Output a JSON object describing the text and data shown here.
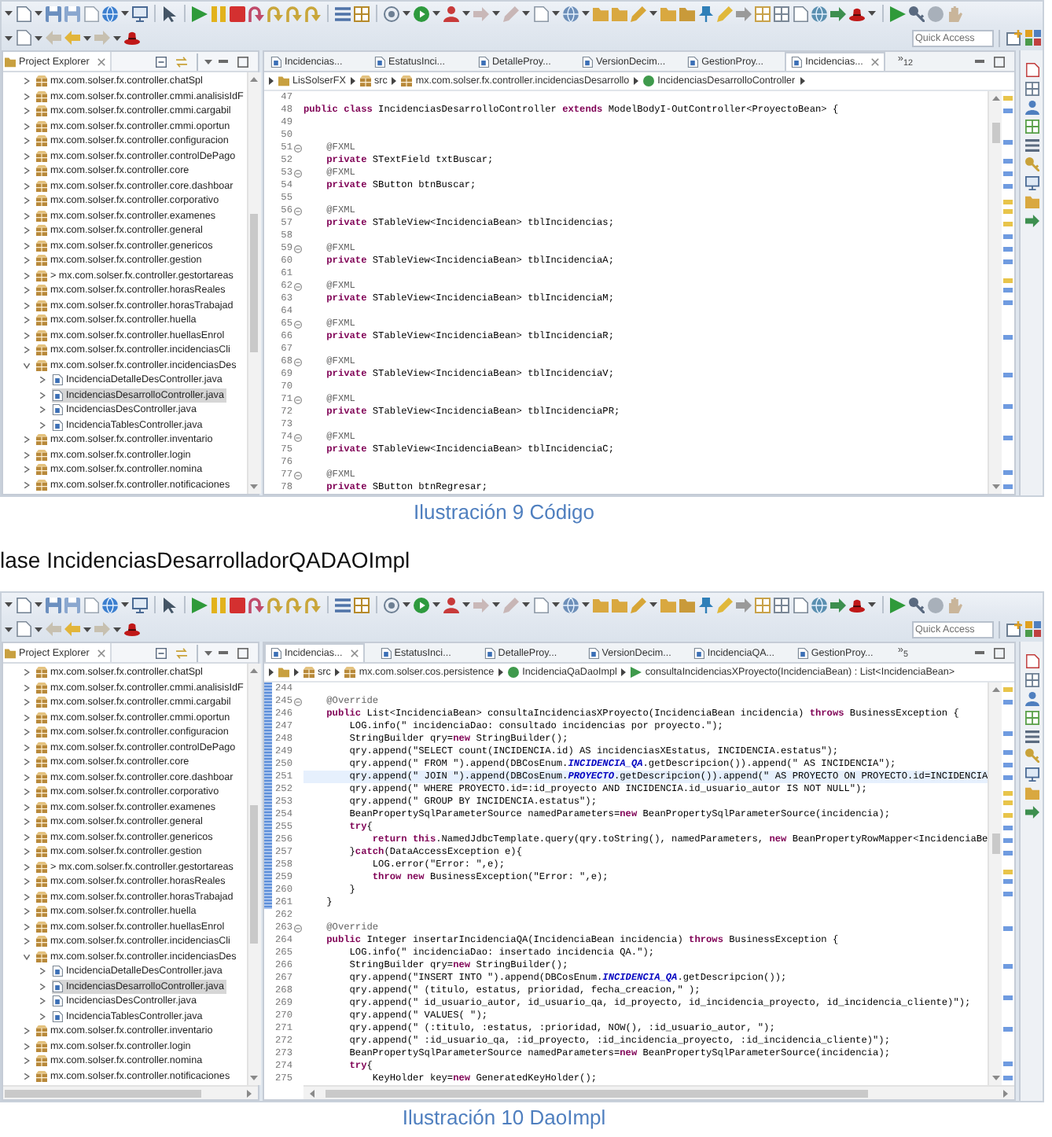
{
  "blocks": [
    {
      "kind": "screenshot",
      "horizontal_scrollbar": false,
      "quick_access": {
        "placeholder": "Quick Access"
      },
      "explorer": {
        "tab": "Project Explorer",
        "items": [
          {
            "label": "mx.com.solser.fx.controller.chatSpl",
            "kind": "package",
            "expanded": false,
            "selected": false
          },
          {
            "label": "mx.com.solser.fx.controller.cmmi.analisisIdF",
            "kind": "package",
            "expanded": false,
            "selected": false
          },
          {
            "label": "mx.com.solser.fx.controller.cmmi.cargabil",
            "kind": "package",
            "expanded": false,
            "selected": false
          },
          {
            "label": "mx.com.solser.fx.controller.cmmi.oportun",
            "kind": "package",
            "expanded": false,
            "selected": false
          },
          {
            "label": "mx.com.solser.fx.controller.configuracion",
            "kind": "package",
            "expanded": false,
            "selected": false
          },
          {
            "label": "mx.com.solser.fx.controller.controlDePago",
            "kind": "package",
            "expanded": false,
            "selected": false
          },
          {
            "label": "mx.com.solser.fx.controller.core",
            "kind": "package",
            "expanded": false,
            "selected": false
          },
          {
            "label": "mx.com.solser.fx.controller.core.dashboar",
            "kind": "package",
            "expanded": false,
            "selected": false
          },
          {
            "label": "mx.com.solser.fx.controller.corporativo",
            "kind": "package",
            "expanded": false,
            "selected": false
          },
          {
            "label": "mx.com.solser.fx.controller.examenes",
            "kind": "package",
            "expanded": false,
            "selected": false
          },
          {
            "label": "mx.com.solser.fx.controller.general",
            "kind": "package",
            "expanded": false,
            "selected": false
          },
          {
            "label": "mx.com.solser.fx.controller.genericos",
            "kind": "package",
            "expanded": false,
            "selected": false
          },
          {
            "label": "mx.com.solser.fx.controller.gestion",
            "kind": "package",
            "expanded": false,
            "selected": false
          },
          {
            "label": "> mx.com.solser.fx.controller.gestortareas",
            "kind": "package",
            "expanded": false,
            "selected": false
          },
          {
            "label": "mx.com.solser.fx.controller.horasReales",
            "kind": "package",
            "expanded": false,
            "selected": false
          },
          {
            "label": "mx.com.solser.fx.controller.horasTrabajad",
            "kind": "package",
            "expanded": false,
            "selected": false
          },
          {
            "label": "mx.com.solser.fx.controller.huella",
            "kind": "package",
            "expanded": false,
            "selected": false
          },
          {
            "label": "mx.com.solser.fx.controller.huellasEnrol",
            "kind": "package",
            "expanded": false,
            "selected": false
          },
          {
            "label": "mx.com.solser.fx.controller.incidenciasCli",
            "kind": "package",
            "expanded": false,
            "selected": false
          },
          {
            "label": "mx.com.solser.fx.controller.incidenciasDes",
            "kind": "package",
            "expanded": true,
            "selected": false,
            "children": [
              {
                "label": "IncidenciaDetalleDesController.java",
                "kind": "java-file",
                "expanded": false,
                "selected": false
              },
              {
                "label": "IncidenciasDesarrolloController.java",
                "kind": "java-file",
                "expanded": false,
                "selected": true
              },
              {
                "label": "IncidenciasDesController.java",
                "kind": "java-file",
                "expanded": false,
                "selected": false
              },
              {
                "label": "IncidenciaTablesController.java",
                "kind": "java-file",
                "expanded": false,
                "selected": false
              }
            ]
          },
          {
            "label": "mx.com.solser.fx.controller.inventario",
            "kind": "package",
            "expanded": false,
            "selected": false
          },
          {
            "label": "mx.com.solser.fx.controller.login",
            "kind": "package",
            "expanded": false,
            "selected": false
          },
          {
            "label": "mx.com.solser.fx.controller.nomina",
            "kind": "package",
            "expanded": false,
            "selected": false
          },
          {
            "label": "mx.com.solser.fx.controller.notificaciones",
            "kind": "package",
            "expanded": false,
            "selected": false
          }
        ]
      },
      "editor": {
        "tabs": [
          {
            "label": "Incidencias...",
            "selected": false
          },
          {
            "label": "EstatusInci...",
            "selected": false
          },
          {
            "label": "DetalleProy...",
            "selected": false
          },
          {
            "label": "VersionDecim...",
            "selected": false
          },
          {
            "label": "GestionProy...",
            "selected": false
          },
          {
            "label": "Incidencias...",
            "selected": true
          }
        ],
        "overflow": "»$_{12}$",
        "breadcrumb": [
          {
            "kind": "project",
            "label": "LisSolserFX"
          },
          {
            "kind": "source-folder",
            "label": "src"
          },
          {
            "kind": "package",
            "label": "mx.com.solser.fx.controller.incidenciasDesarrollo"
          },
          {
            "kind": "class",
            "label": "IncidenciasDesarrolloController"
          }
        ],
        "lines": [
          {
            "number": "47",
            "foldable": false,
            "changed": false,
            "current": false
          },
          {
            "number": "48",
            "kind": "code",
            "text": "**public class** IncidenciasDesarrolloController **extends** ModelBodyI-OutController<ProyectoBean> {",
            "foldable": false,
            "changed": false,
            "current": false
          },
          {
            "number": "49",
            "foldable": false,
            "changed": false,
            "current": false
          },
          {
            "number": "50",
            "foldable": false,
            "changed": false,
            "current": false
          },
          {
            "number": "51",
            "kind": "annotation",
            "text": "    @FXML",
            "foldable": true,
            "changed": false,
            "current": false
          },
          {
            "number": "52",
            "kind": "code",
            "text": "    **private** STextField txtBuscar;",
            "foldable": false,
            "changed": false,
            "current": false
          },
          {
            "number": "53",
            "kind": "annotation",
            "text": "    @FXML",
            "foldable": true,
            "changed": false,
            "current": false
          },
          {
            "number": "54",
            "kind": "code",
            "text": "    **private** SButton btnBuscar;",
            "foldable": false,
            "changed": false,
            "current": false
          },
          {
            "number": "55",
            "foldable": false,
            "changed": false,
            "current": false
          },
          {
            "number": "56",
            "kind": "annotation",
            "text": "    @FXML",
            "foldable": true,
            "changed": false,
            "current": false
          },
          {
            "number": "57",
            "kind": "code",
            "text": "    **private** STableView<IncidenciaBean> tblIncidencias;",
            "foldable": false,
            "changed": false,
            "current": false
          },
          {
            "number": "58",
            "foldable": false,
            "changed": false,
            "current": false
          },
          {
            "number": "59",
            "kind": "annotation",
            "text": "    @FXML",
            "foldable": true,
            "changed": false,
            "current": false
          },
          {
            "number": "60",
            "kind": "code",
            "text": "    **private** STableView<IncidenciaBean> tblIncidenciaA;",
            "foldable": false,
            "changed": false,
            "current": false
          },
          {
            "number": "61",
            "foldable": false,
            "changed": false,
            "current": false
          },
          {
            "number": "62",
            "kind": "annotation",
            "text": "    @FXML",
            "foldable": true,
            "changed": false,
            "current": false
          },
          {
            "number": "63",
            "kind": "code",
            "text": "    **private** STableView<IncidenciaBean> tblIncidenciaM;",
            "foldable": false,
            "changed": false,
            "current": false
          },
          {
            "number": "64",
            "foldable": false,
            "changed": false,
            "current": false
          },
          {
            "number": "65",
            "kind": "annotation",
            "text": "    @FXML",
            "foldable": true,
            "changed": false,
            "current": false
          },
          {
            "number": "66",
            "kind": "code",
            "text": "    **private** STableView<IncidenciaBean> tblIncidenciaR;",
            "foldable": false,
            "changed": false,
            "current": false
          },
          {
            "number": "67",
            "foldable": false,
            "changed": false,
            "current": false
          },
          {
            "number": "68",
            "kind": "annotation",
            "text": "    @FXML",
            "foldable": true,
            "changed": false,
            "current": false
          },
          {
            "number": "69",
            "kind": "code",
            "text": "    **private** STableView<IncidenciaBean> tblIncidenciaV;",
            "foldable": false,
            "changed": false,
            "current": false
          },
          {
            "number": "70",
            "foldable": false,
            "changed": false,
            "current": false
          },
          {
            "number": "71",
            "kind": "annotation",
            "text": "    @FXML",
            "foldable": true,
            "changed": false,
            "current": false
          },
          {
            "number": "72",
            "kind": "code",
            "text": "    **private** STableView<IncidenciaBean> tblIncidenciaPR;",
            "foldable": false,
            "changed": false,
            "current": false
          },
          {
            "number": "73",
            "foldable": false,
            "changed": false,
            "current": false
          },
          {
            "number": "74",
            "kind": "annotation",
            "text": "    @FXML",
            "foldable": true,
            "changed": false,
            "current": false
          },
          {
            "number": "75",
            "kind": "code",
            "text": "    **private** STableView<IncidenciaBean> tblIncidenciaC;",
            "foldable": false,
            "changed": false,
            "current": false
          },
          {
            "number": "76",
            "foldable": false,
            "changed": false,
            "current": false
          },
          {
            "number": "77",
            "kind": "annotation",
            "text": "    @FXML",
            "foldable": true,
            "changed": false,
            "current": false
          },
          {
            "number": "78",
            "kind": "code",
            "text": "    **private** SButton btnRegresar;",
            "foldable": false,
            "changed": false,
            "current": false
          }
        ]
      }
    },
    {
      "kind": "caption",
      "text": "Ilustración 9 Código"
    },
    {
      "kind": "paragraph",
      "text": "lase IncidenciasDesarrolladorQADAOImpl"
    },
    {
      "kind": "screenshot",
      "horizontal_scrollbar": true,
      "quick_access": {
        "placeholder": "Quick Access"
      },
      "explorer": {
        "tab": "Project Explorer",
        "items": [
          {
            "label": "mx.com.solser.fx.controller.chatSpl",
            "kind": "package",
            "expanded": false,
            "selected": false
          },
          {
            "label": "mx.com.solser.fx.controller.cmmi.analisisIdF",
            "kind": "package",
            "expanded": false,
            "selected": false
          },
          {
            "label": "mx.com.solser.fx.controller.cmmi.cargabil",
            "kind": "package",
            "expanded": false,
            "selected": false
          },
          {
            "label": "mx.com.solser.fx.controller.cmmi.oportun",
            "kind": "package",
            "expanded": false,
            "selected": false
          },
          {
            "label": "mx.com.solser.fx.controller.configuracion",
            "kind": "package",
            "expanded": false,
            "selected": false
          },
          {
            "label": "mx.com.solser.fx.controller.controlDePago",
            "kind": "package",
            "expanded": false,
            "selected": false
          },
          {
            "label": "mx.com.solser.fx.controller.core",
            "kind": "package",
            "expanded": false,
            "selected": false
          },
          {
            "label": "mx.com.solser.fx.controller.core.dashboar",
            "kind": "package",
            "expanded": false,
            "selected": false
          },
          {
            "label": "mx.com.solser.fx.controller.corporativo",
            "kind": "package",
            "expanded": false,
            "selected": false
          },
          {
            "label": "mx.com.solser.fx.controller.examenes",
            "kind": "package",
            "expanded": false,
            "selected": false
          },
          {
            "label": "mx.com.solser.fx.controller.general",
            "kind": "package",
            "expanded": false,
            "selected": false
          },
          {
            "label": "mx.com.solser.fx.controller.genericos",
            "kind": "package",
            "expanded": false,
            "selected": false
          },
          {
            "label": "mx.com.solser.fx.controller.gestion",
            "kind": "package",
            "expanded": false,
            "selected": false
          },
          {
            "label": "> mx.com.solser.fx.controller.gestortareas",
            "kind": "package",
            "expanded": false,
            "selected": false
          },
          {
            "label": "mx.com.solser.fx.controller.horasReales",
            "kind": "package",
            "expanded": false,
            "selected": false
          },
          {
            "label": "mx.com.solser.fx.controller.horasTrabajad",
            "kind": "package",
            "expanded": false,
            "selected": false
          },
          {
            "label": "mx.com.solser.fx.controller.huella",
            "kind": "package",
            "expanded": false,
            "selected": false
          },
          {
            "label": "mx.com.solser.fx.controller.huellasEnrol",
            "kind": "package",
            "expanded": false,
            "selected": false
          },
          {
            "label": "mx.com.solser.fx.controller.incidenciasCli",
            "kind": "package",
            "expanded": false,
            "selected": false
          },
          {
            "label": "mx.com.solser.fx.controller.incidenciasDes",
            "kind": "package",
            "expanded": true,
            "selected": false,
            "children": [
              {
                "label": "IncidenciaDetalleDesController.java",
                "kind": "java-file",
                "expanded": false,
                "selected": false
              },
              {
                "label": "IncidenciasDesarrolloController.java",
                "kind": "java-file",
                "expanded": false,
                "selected": true
              },
              {
                "label": "IncidenciasDesController.java",
                "kind": "java-file",
                "expanded": false,
                "selected": false
              },
              {
                "label": "IncidenciaTablesController.java",
                "kind": "java-file",
                "expanded": false,
                "selected": false
              }
            ]
          },
          {
            "label": "mx.com.solser.fx.controller.inventario",
            "kind": "package",
            "expanded": false,
            "selected": false
          },
          {
            "label": "mx.com.solser.fx.controller.login",
            "kind": "package",
            "expanded": false,
            "selected": false
          },
          {
            "label": "mx.com.solser.fx.controller.nomina",
            "kind": "package",
            "expanded": false,
            "selected": false
          },
          {
            "label": "mx.com.solser.fx.controller.notificaciones",
            "kind": "package",
            "expanded": false,
            "selected": false
          }
        ]
      },
      "editor": {
        "tabs": [
          {
            "label": "Incidencias...",
            "selected": true
          },
          {
            "label": "EstatusInci...",
            "selected": false
          },
          {
            "label": "DetalleProy...",
            "selected": false
          },
          {
            "label": "VersionDecim...",
            "selected": false
          },
          {
            "label": "IncidenciaQA...",
            "selected": false
          },
          {
            "label": "GestionProy...",
            "selected": false
          }
        ],
        "overflow": "»$_{5}$",
        "breadcrumb": [
          {
            "kind": "project"
          },
          {
            "kind": "source-folder",
            "label": "src"
          },
          {
            "kind": "package",
            "label": "mx.com.solser.cos.persistence"
          },
          {
            "kind": "class",
            "label": "IncidenciaQaDaoImpl"
          },
          {
            "kind": "method",
            "label": "consultaIncidenciasXProyecto(IncidenciaBean) : List<IncidenciaBean>"
          }
        ],
        "lines": [
          {
            "number": "244",
            "foldable": false,
            "changed": true,
            "current": false
          },
          {
            "number": "245",
            "kind": "annotation",
            "text": "    @Override",
            "foldable": true,
            "changed": true,
            "current": false
          },
          {
            "number": "246",
            "kind": "code",
            "text": "    **public** List<IncidenciaBean> consultaIncidenciasXProyecto(IncidenciaBean incidencia) **throws** BusinessException {",
            "foldable": false,
            "changed": true,
            "current": false
          },
          {
            "number": "247",
            "kind": "code",
            "text": "        LOG.info(\" incidenciaDao: consultado incidencias por proyecto.\");",
            "foldable": false,
            "changed": true,
            "current": false
          },
          {
            "number": "248",
            "kind": "code",
            "text": "        StringBuilder qry=**new** StringBuilder();",
            "foldable": false,
            "changed": true,
            "current": false
          },
          {
            "number": "249",
            "kind": "code",
            "text": "        qry.append(\"SELECT count(INCIDENCIA.id) AS incidenciasXEstatus, INCIDENCIA.estatus\");",
            "foldable": false,
            "changed": true,
            "current": false
          },
          {
            "number": "250",
            "kind": "code",
            "text": "        qry.append(\" FROM \").append(DBCosEnum.*INCIDENCIA_QA*.getDescripcion()).append(\" AS INCIDENCIA\");",
            "foldable": false,
            "changed": true,
            "current": false
          },
          {
            "number": "251",
            "kind": "code",
            "text": "        qry.append(\" JOIN \").append(DBCosEnum.*PROYECTO*.getDescripcion()).append(\" AS PROYECTO ON PROYECTO.id=INCIDENCIA",
            "foldable": false,
            "changed": true,
            "current": true
          },
          {
            "number": "252",
            "kind": "code",
            "text": "        qry.append(\" WHERE PROYECTO.id=:id_proyecto AND INCIDENCIA.id_usuario_autor IS NOT NULL\");",
            "foldable": false,
            "changed": true,
            "current": false
          },
          {
            "number": "253",
            "kind": "code",
            "text": "        qry.append(\" GROUP BY INCIDENCIA.estatus\");",
            "foldable": false,
            "changed": true,
            "current": false
          },
          {
            "number": "254",
            "kind": "code",
            "text": "        BeanPropertySqlParameterSource namedParameters=**new** BeanPropertySqlParameterSource(incidencia);",
            "foldable": false,
            "changed": true,
            "current": false
          },
          {
            "number": "255",
            "kind": "code",
            "text": "        **try**{",
            "foldable": false,
            "changed": true,
            "current": false
          },
          {
            "number": "256",
            "kind": "code",
            "text": "            **return this**.NamedJdbcTemplate.query(qry.toString(), namedParameters, **new** BeanPropertyRowMapper<IncidenciaBe",
            "foldable": false,
            "changed": true,
            "current": false
          },
          {
            "number": "257",
            "kind": "code",
            "text": "        }**catch**(DataAccessException e){",
            "foldable": false,
            "changed": true,
            "current": false
          },
          {
            "number": "258",
            "kind": "code",
            "text": "            LOG.error(\"Error: \",e);",
            "foldable": false,
            "changed": true,
            "current": false
          },
          {
            "number": "259",
            "kind": "code",
            "text": "            **throw new** BusinessException(\"Error: \",e);",
            "foldable": false,
            "changed": true,
            "current": false
          },
          {
            "number": "260",
            "kind": "code",
            "text": "        }",
            "foldable": false,
            "changed": true,
            "current": false
          },
          {
            "number": "261",
            "kind": "code",
            "text": "    }",
            "foldable": false,
            "changed": true,
            "current": false
          },
          {
            "number": "262",
            "foldable": false,
            "changed": false,
            "current": false
          },
          {
            "number": "263",
            "kind": "annotation",
            "text": "    @Override",
            "foldable": true,
            "changed": false,
            "current": false
          },
          {
            "number": "264",
            "kind": "code",
            "text": "    **public** Integer insertarIncidenciaQA(IncidenciaBean incidencia) **throws** BusinessException {",
            "foldable": false,
            "changed": false,
            "current": false
          },
          {
            "number": "265",
            "kind": "code",
            "text": "        LOG.info(\" incidenciaDao: insertado incidencia QA.\");",
            "foldable": false,
            "changed": false,
            "current": false
          },
          {
            "number": "266",
            "kind": "code",
            "text": "        StringBuilder qry=**new** StringBuilder();",
            "foldable": false,
            "changed": false,
            "current": false
          },
          {
            "number": "267",
            "kind": "code",
            "text": "        qry.append(\"INSERT INTO \").append(DBCosEnum.*INCIDENCIA_QA*.getDescripcion());",
            "foldable": false,
            "changed": false,
            "current": false
          },
          {
            "number": "268",
            "kind": "code",
            "text": "        qry.append(\" (titulo, estatus, prioridad, fecha_creacion,\" );",
            "foldable": false,
            "changed": false,
            "current": false
          },
          {
            "number": "269",
            "kind": "code",
            "text": "        qry.append(\" id_usuario_autor, id_usuario_qa, id_proyecto, id_incidencia_proyecto, id_incidencia_cliente)\");",
            "foldable": false,
            "changed": false,
            "current": false
          },
          {
            "number": "270",
            "kind": "code",
            "text": "        qry.append(\" VALUES( \");",
            "foldable": false,
            "changed": false,
            "current": false
          },
          {
            "number": "271",
            "kind": "code",
            "text": "        qry.append(\" (:titulo, :estatus, :prioridad, NOW(), :id_usuario_autor, \");",
            "foldable": false,
            "changed": false,
            "current": false
          },
          {
            "number": "272",
            "kind": "code",
            "text": "        qry.append(\" :id_usuario_qa, :id_proyecto, :id_incidencia_proyecto, :id_incidencia_cliente)\");",
            "foldable": false,
            "changed": false,
            "current": false
          },
          {
            "number": "273",
            "kind": "code",
            "text": "        BeanPropertySqlParameterSource namedParameters=**new** BeanPropertySqlParameterSource(incidencia);",
            "foldable": false,
            "changed": false,
            "current": false
          },
          {
            "number": "274",
            "kind": "code",
            "text": "        **try**{",
            "foldable": false,
            "changed": false,
            "current": false
          },
          {
            "number": "275",
            "kind": "code",
            "text": "            KeyHolder key=**new** GeneratedKeyHolder();",
            "foldable": false,
            "changed": false,
            "current": false
          }
        ]
      }
    },
    {
      "kind": "caption",
      "text": "Ilustración 10 DaoImpl"
    }
  ]
}
